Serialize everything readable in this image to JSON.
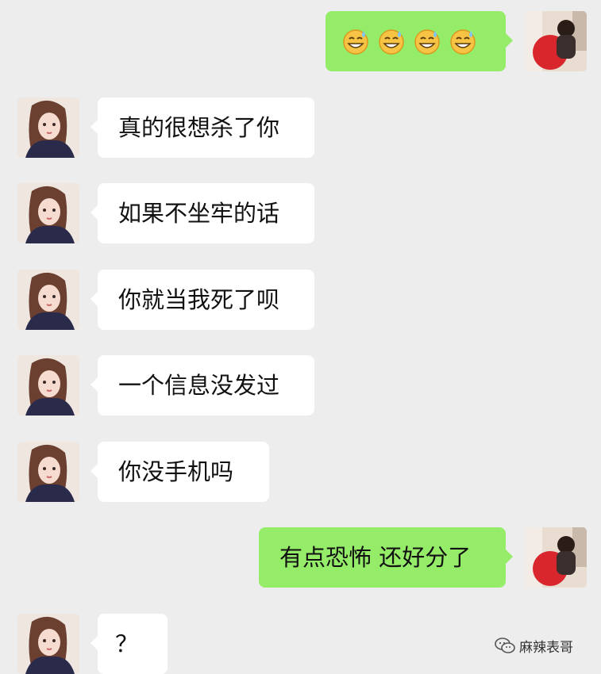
{
  "chat": {
    "messages": [
      {
        "side": "out",
        "type": "emoji",
        "emoji_name": "sweat-smile-emoji",
        "count": 4
      },
      {
        "side": "in",
        "text": "真的很想杀了你"
      },
      {
        "side": "in",
        "text": "如果不坐牢的话"
      },
      {
        "side": "in",
        "text": "你就当我死了呗"
      },
      {
        "side": "in",
        "text": "一个信息没发过"
      },
      {
        "side": "in",
        "text": "你没手机吗"
      },
      {
        "side": "out",
        "text": "有点恐怖 还好分了"
      },
      {
        "side": "in",
        "text": "？"
      }
    ]
  },
  "watermark": {
    "text": "麻辣表哥",
    "icon": "wechat-icon"
  },
  "colors": {
    "background": "#ededed",
    "incoming_bubble": "#ffffff",
    "outgoing_bubble": "#95ec69"
  }
}
